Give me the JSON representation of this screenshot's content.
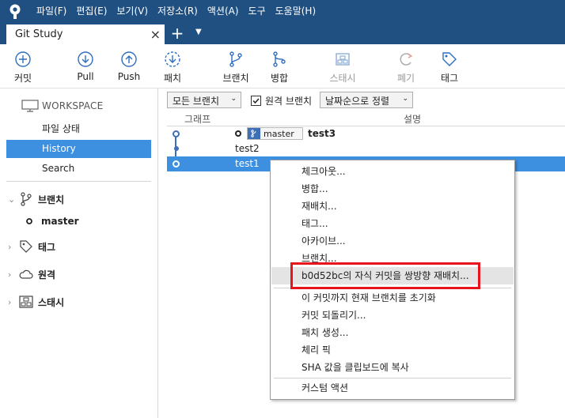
{
  "menu": [
    "파일(F)",
    "편집(E)",
    "보기(V)",
    "저장소(R)",
    "액션(A)",
    "도구",
    "도움말(H)"
  ],
  "tab": {
    "title": "Git Study",
    "close": "×",
    "new": "+",
    "dropdown": "▼"
  },
  "toolbar": {
    "commit": "커밋",
    "pull": "Pull",
    "push": "Push",
    "fetch": "패치",
    "branch": "브랜치",
    "merge": "병합",
    "stash": "스태시",
    "discard": "폐기",
    "tag": "태그"
  },
  "sidebar": {
    "workspace": "WORKSPACE",
    "items": [
      "파일 상태",
      "History",
      "Search"
    ],
    "groups": {
      "branches": "브랜치",
      "tags": "태그",
      "remotes": "원격",
      "stashes": "스태시"
    },
    "branch_master": "master"
  },
  "filter": {
    "branches": "모든 브랜치",
    "remote": "원격 브랜치",
    "remote_checked": true,
    "sort": "날짜순으로 정렬"
  },
  "columns": {
    "graph": "그래프",
    "desc": "설명"
  },
  "commits": [
    {
      "message": "test3",
      "branch": "master"
    },
    {
      "message": "test2"
    },
    {
      "message": "test1"
    }
  ],
  "context_menu": {
    "items": [
      "체크아웃...",
      "병합...",
      "재배치...",
      "태그...",
      "아카이브...",
      "브랜치...",
      "b0d52bc의 자식 커밋을 쌍방향 재배치...",
      "이 커밋까지 현재 브랜치를 초기화",
      "커밋 되돌리기...",
      "패치 생성...",
      "체리 픽",
      "SHA 값을 클립보드에 복사",
      "커스텀 액션"
    ]
  },
  "colors": {
    "brand": "#205081",
    "accent": "#3d8fe0",
    "highlight": "#e8131b"
  }
}
